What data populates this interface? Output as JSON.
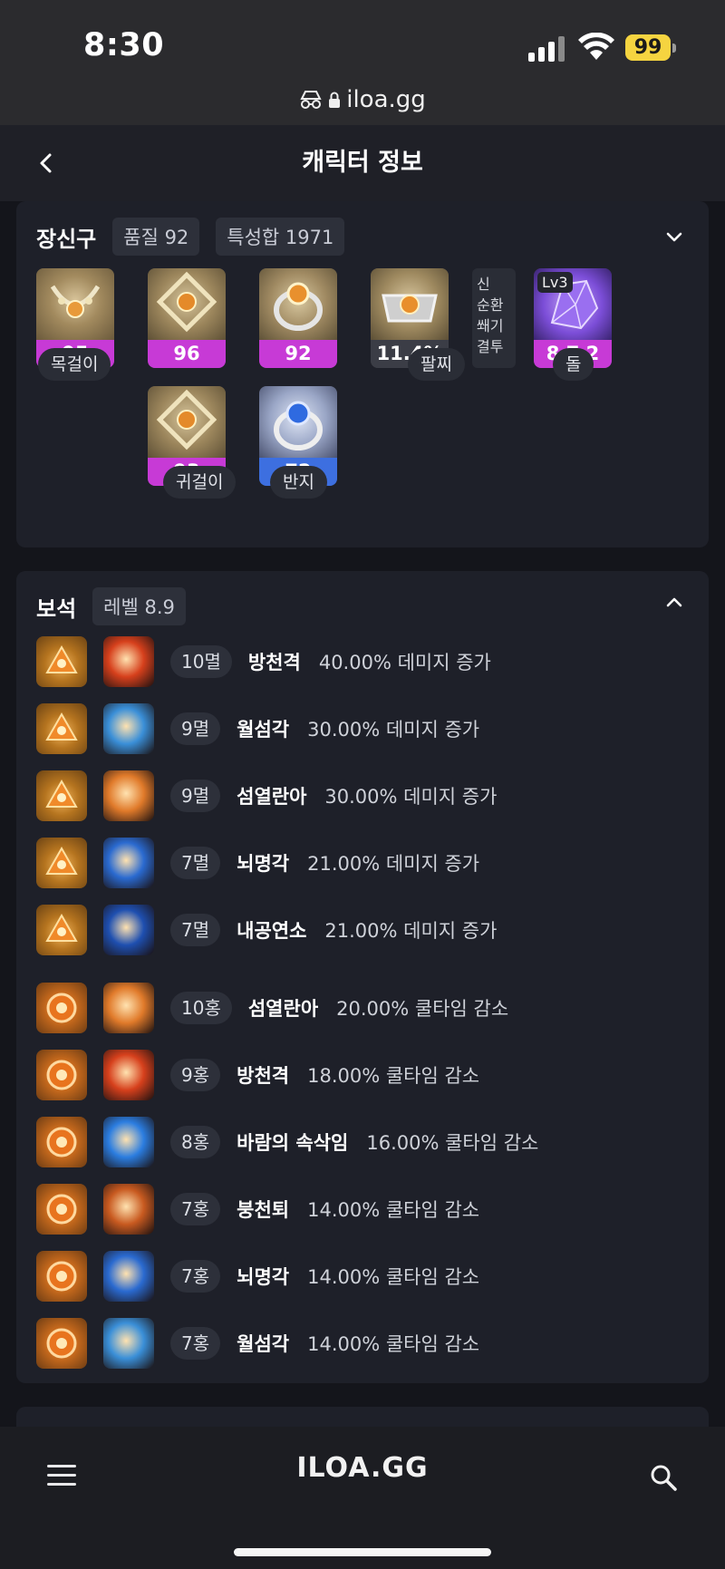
{
  "status": {
    "time": "8:30",
    "battery": "99"
  },
  "browser": {
    "url": "iloa.gg"
  },
  "header": {
    "title": "캐릭터 정보"
  },
  "equipment": {
    "title": "장신구",
    "tags": [
      "품질 92",
      "특성합 1971"
    ],
    "items": [
      {
        "value": "95",
        "bar_color": "#c73ad6",
        "label": "목걸이"
      },
      {
        "value": "96",
        "bar_color": "#c73ad6",
        "label": ""
      },
      {
        "value": "92",
        "bar_color": "#c73ad6",
        "label": ""
      },
      {
        "value": "11.4%",
        "bar_color": "#3b3d46",
        "label": "팔찌"
      },
      {
        "value": "8 7 2",
        "bar_color": "#c73ad6",
        "label": "돌",
        "badge": "Lv3"
      },
      {
        "value": "93",
        "bar_color": "#c73ad6",
        "label": "귀걸이"
      },
      {
        "value": "72",
        "bar_color": "#3d6fe0",
        "label": "반지"
      }
    ],
    "bracelet_effects": [
      "신",
      "순환",
      "쐐기",
      "결투"
    ]
  },
  "gems": {
    "title": "보석",
    "tag": "레벨 8.9",
    "rows": [
      {
        "level": "10멸",
        "skill": "방천격",
        "effect": "40.00% 데미지 증가",
        "type": "dmg",
        "skill_color": "#d6401c"
      },
      {
        "level": "9멸",
        "skill": "월섬각",
        "effect": "30.00% 데미지 증가",
        "type": "dmg",
        "skill_color": "#3a8fd8"
      },
      {
        "level": "9멸",
        "skill": "섬열란아",
        "effect": "30.00% 데미지 증가",
        "type": "dmg",
        "skill_color": "#e07a2a"
      },
      {
        "level": "7멸",
        "skill": "뇌명각",
        "effect": "21.00% 데미지 증가",
        "type": "dmg",
        "skill_color": "#2a6ad0"
      },
      {
        "level": "7멸",
        "skill": "내공연소",
        "effect": "21.00% 데미지 증가",
        "type": "dmg",
        "skill_color": "#1e4fb0"
      },
      {
        "level": "10홍",
        "skill": "섬열란아",
        "effect": "20.00% 쿨타임 감소",
        "type": "cd",
        "skill_color": "#e07a2a"
      },
      {
        "level": "9홍",
        "skill": "방천격",
        "effect": "18.00% 쿨타임 감소",
        "type": "cd",
        "skill_color": "#d6401c"
      },
      {
        "level": "8홍",
        "skill": "바람의 속삭임",
        "effect": "16.00% 쿨타임 감소",
        "type": "cd",
        "skill_color": "#2b7de0"
      },
      {
        "level": "7홍",
        "skill": "붕천퇴",
        "effect": "14.00% 쿨타임 감소",
        "type": "cd",
        "skill_color": "#c85a20"
      },
      {
        "level": "7홍",
        "skill": "뇌명각",
        "effect": "14.00% 쿨타임 감소",
        "type": "cd",
        "skill_color": "#2a6ad0"
      },
      {
        "level": "7홍",
        "skill": "월섬각",
        "effect": "14.00% 쿨타임 감소",
        "type": "cd",
        "skill_color": "#3a8fd8"
      }
    ]
  },
  "nav": {
    "logo": "ILOA.GG"
  }
}
